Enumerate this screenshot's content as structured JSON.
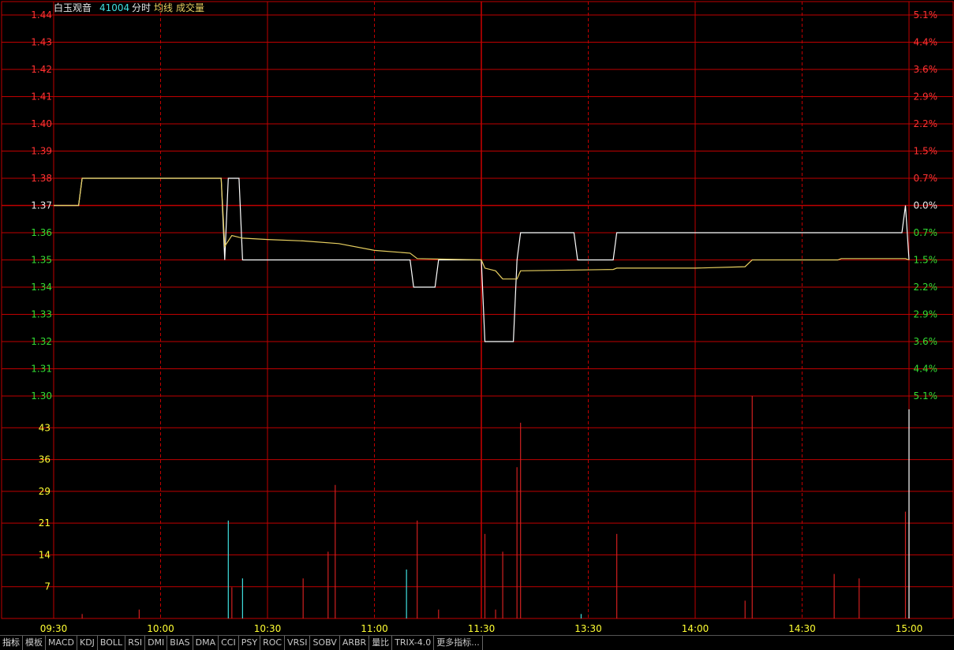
{
  "header": {
    "name": "白玉观音",
    "code": "41004",
    "items": [
      "分时",
      "均线",
      "成交量"
    ]
  },
  "colors": {
    "background": "#000000",
    "grid": "#c00000",
    "up": "#ff3333",
    "down": "#33dd33",
    "volume_tick": "#ffff33",
    "time_label": "#ffff33",
    "price_line": "#ffffff",
    "avg_line": "#e8d060",
    "vol_up": "#d02020",
    "vol_down": "#40e0e0"
  },
  "tabs": [
    "指标",
    "模板",
    "MACD",
    "KDJ",
    "BOLL",
    "RSI",
    "DMI",
    "BIAS",
    "DMA",
    "CCI",
    "PSY",
    "ROC",
    "VRSI",
    "SOBV",
    "ARBR",
    "量比",
    "TRIX-4.0",
    "更多指标..."
  ],
  "chart_data": {
    "type": "line",
    "title": "白玉观音 41004 分时",
    "prev_close": 1.37,
    "price_axis": {
      "ticks": [
        "1.44",
        "1.43",
        "1.42",
        "1.41",
        "1.40",
        "1.39",
        "1.38",
        "1.37",
        "1.36",
        "1.35",
        "1.34",
        "1.33",
        "1.32",
        "1.31",
        "1.30"
      ],
      "ylim": [
        1.3,
        1.44
      ]
    },
    "pct_axis": {
      "ticks": [
        "5.1%",
        "4.4%",
        "3.6%",
        "2.9%",
        "2.2%",
        "1.5%",
        "0.7%",
        "0.0%",
        "0.7%",
        "1.5%",
        "2.2%",
        "2.9%",
        "3.6%",
        "4.4%",
        "5.1%"
      ]
    },
    "volume_axis": {
      "ticks": [
        "43",
        "36",
        "29",
        "21",
        "14",
        "7"
      ],
      "ylim": [
        0,
        50
      ]
    },
    "time_axis": {
      "labels": [
        "09:30",
        "10:00",
        "10:30",
        "11:00",
        "11:30",
        "13:30",
        "14:00",
        "14:30",
        "15:00"
      ],
      "total_minutes": 240
    },
    "series": [
      {
        "name": "分时",
        "points": [
          [
            0,
            1.37
          ],
          [
            7,
            1.37
          ],
          [
            8,
            1.38
          ],
          [
            47,
            1.38
          ],
          [
            48,
            1.35
          ],
          [
            49,
            1.38
          ],
          [
            52,
            1.38
          ],
          [
            53,
            1.35
          ],
          [
            100,
            1.35
          ],
          [
            101,
            1.34
          ],
          [
            107,
            1.34
          ],
          [
            108,
            1.35
          ],
          [
            120,
            1.35
          ],
          [
            121,
            1.32
          ],
          [
            129,
            1.32
          ],
          [
            130,
            1.35
          ],
          [
            131,
            1.36
          ],
          [
            146,
            1.36
          ],
          [
            147,
            1.35
          ],
          [
            157,
            1.35
          ],
          [
            158,
            1.36
          ],
          [
            238,
            1.36
          ],
          [
            239,
            1.37
          ],
          [
            240,
            1.35
          ]
        ]
      },
      {
        "name": "均线",
        "points": [
          [
            0,
            1.37
          ],
          [
            7,
            1.37
          ],
          [
            8,
            1.38
          ],
          [
            47,
            1.38
          ],
          [
            48,
            1.355
          ],
          [
            50,
            1.359
          ],
          [
            53,
            1.358
          ],
          [
            60,
            1.3575
          ],
          [
            70,
            1.357
          ],
          [
            80,
            1.356
          ],
          [
            90,
            1.3535
          ],
          [
            100,
            1.3525
          ],
          [
            102,
            1.3505
          ],
          [
            120,
            1.35
          ],
          [
            121,
            1.347
          ],
          [
            124,
            1.346
          ],
          [
            126,
            1.343
          ],
          [
            130,
            1.343
          ],
          [
            131,
            1.346
          ],
          [
            157,
            1.3465
          ],
          [
            158,
            1.347
          ],
          [
            180,
            1.347
          ],
          [
            194,
            1.3475
          ],
          [
            196,
            1.35
          ],
          [
            220,
            1.35
          ],
          [
            221,
            1.3505
          ],
          [
            239,
            1.3505
          ],
          [
            240,
            1.35
          ]
        ]
      }
    ],
    "volume": [
      {
        "t": 8,
        "v": 1,
        "dir": "up"
      },
      {
        "t": 24,
        "v": 2,
        "dir": "up"
      },
      {
        "t": 49,
        "v": 22,
        "dir": "down"
      },
      {
        "t": 50,
        "v": 7,
        "dir": "up"
      },
      {
        "t": 53,
        "v": 9,
        "dir": "down"
      },
      {
        "t": 70,
        "v": 9,
        "dir": "up"
      },
      {
        "t": 77,
        "v": 15,
        "dir": "up"
      },
      {
        "t": 79,
        "v": 30,
        "dir": "up"
      },
      {
        "t": 99,
        "v": 11,
        "dir": "down"
      },
      {
        "t": 102,
        "v": 22,
        "dir": "up"
      },
      {
        "t": 108,
        "v": 2,
        "dir": "up"
      },
      {
        "t": 121,
        "v": 19,
        "dir": "up"
      },
      {
        "t": 124,
        "v": 2,
        "dir": "up"
      },
      {
        "t": 126,
        "v": 15,
        "dir": "up"
      },
      {
        "t": 130,
        "v": 34,
        "dir": "up"
      },
      {
        "t": 131,
        "v": 44,
        "dir": "up"
      },
      {
        "t": 148,
        "v": 1,
        "dir": "down"
      },
      {
        "t": 158,
        "v": 19,
        "dir": "up"
      },
      {
        "t": 194,
        "v": 4,
        "dir": "up"
      },
      {
        "t": 196,
        "v": 50,
        "dir": "up"
      },
      {
        "t": 219,
        "v": 10,
        "dir": "up"
      },
      {
        "t": 226,
        "v": 9,
        "dir": "up"
      },
      {
        "t": 239,
        "v": 24,
        "dir": "up"
      },
      {
        "t": 240,
        "v": 47,
        "dir": "flat"
      }
    ]
  }
}
